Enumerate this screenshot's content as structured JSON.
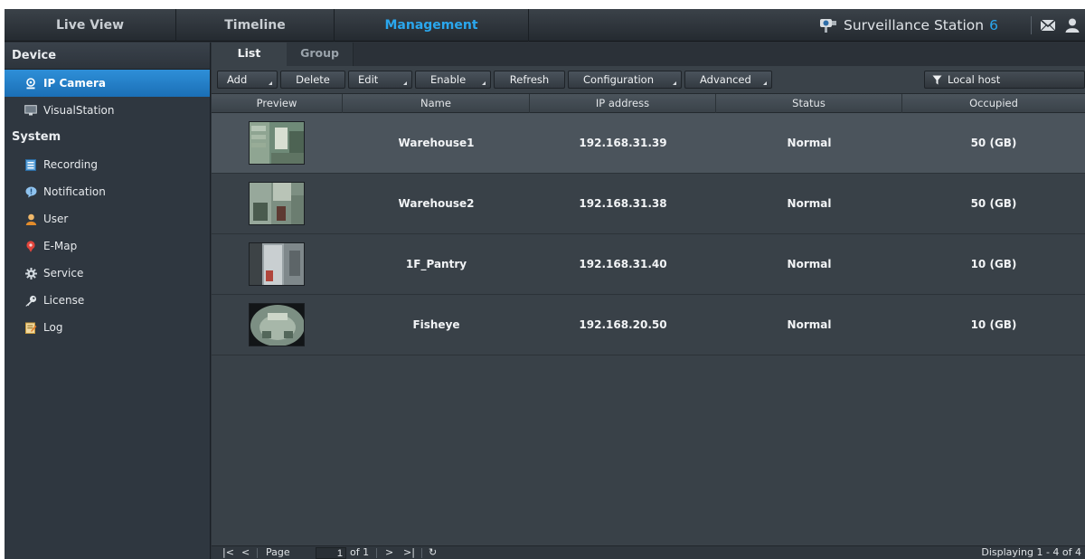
{
  "nav": {
    "tabs": [
      "Live View",
      "Timeline",
      "Management"
    ],
    "active_tab": "Management",
    "brand": "Surveillance Station",
    "brand_version": "6"
  },
  "sidebar": {
    "device_heading": "Device",
    "device_items": [
      {
        "label": "IP Camera",
        "icon": "camera-icon",
        "active": true
      },
      {
        "label": "VisualStation",
        "icon": "monitor-icon",
        "active": false
      }
    ],
    "system_heading": "System",
    "system_items": [
      {
        "label": "Recording",
        "icon": "recording-icon"
      },
      {
        "label": "Notification",
        "icon": "notification-icon"
      },
      {
        "label": "User",
        "icon": "user-icon"
      },
      {
        "label": "E-Map",
        "icon": "map-pin-icon"
      },
      {
        "label": "Service",
        "icon": "gear-icon"
      },
      {
        "label": "License",
        "icon": "key-icon"
      },
      {
        "label": "Log",
        "icon": "log-icon"
      }
    ]
  },
  "subtabs": [
    "List",
    "Group"
  ],
  "toolbar": {
    "add": "Add",
    "delete": "Delete",
    "edit": "Edit",
    "enable": "Enable",
    "refresh": "Refresh",
    "configuration": "Configuration",
    "advanced": "Advanced",
    "filter": "Local host"
  },
  "table": {
    "columns": [
      "Preview",
      "Name",
      "IP address",
      "Status",
      "Occupied"
    ],
    "rows": [
      {
        "name": "Warehouse1",
        "ip": "192.168.31.39",
        "status": "Normal",
        "occupied": "50 (GB)",
        "selected": true
      },
      {
        "name": "Warehouse2",
        "ip": "192.168.31.38",
        "status": "Normal",
        "occupied": "50 (GB)",
        "selected": false
      },
      {
        "name": "1F_Pantry",
        "ip": "192.168.31.40",
        "status": "Normal",
        "occupied": "10 (GB)",
        "selected": false
      },
      {
        "name": "Fisheye",
        "ip": "192.168.20.50",
        "status": "Normal",
        "occupied": "10 (GB)",
        "selected": false
      }
    ]
  },
  "pager": {
    "page_label": "Page",
    "page_value": "1",
    "of_label": "of 1",
    "displaying": "Displaying 1 - 4 of 4"
  },
  "colors": {
    "accent": "#2aa7ee",
    "sidebar_active": "#1f7cc6"
  }
}
